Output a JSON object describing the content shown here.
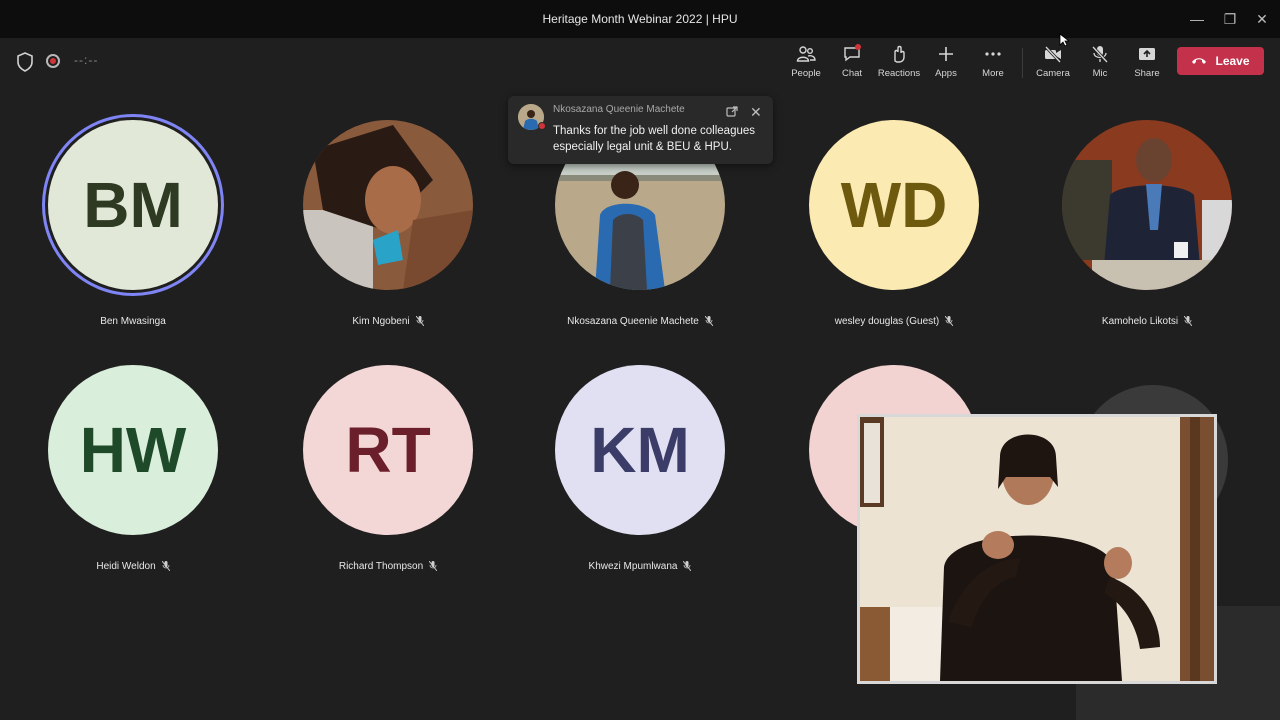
{
  "window": {
    "title": "Heritage Month Webinar 2022 | HPU"
  },
  "toolbar": {
    "timer": "--:--",
    "buttons": [
      {
        "icon": "people-icon",
        "label": "People"
      },
      {
        "icon": "chat-icon",
        "label": "Chat"
      },
      {
        "icon": "reactions-icon",
        "label": "Reactions"
      },
      {
        "icon": "apps-icon",
        "label": "Apps"
      },
      {
        "icon": "more-icon",
        "label": "More"
      },
      {
        "icon": "camera-off-icon",
        "label": "Camera"
      },
      {
        "icon": "mic-off-icon",
        "label": "Mic"
      },
      {
        "icon": "share-icon",
        "label": "Share"
      }
    ],
    "leave_label": "Leave",
    "leave_color": "#c4314b"
  },
  "participants": [
    {
      "initials": "BM",
      "name": "Ben Mwasinga",
      "bg": "#e2e8d8",
      "fg": "#2f3a22",
      "speaking": true,
      "muted": false
    },
    {
      "initials": "",
      "name": "Kim Ngobeni",
      "photo": true,
      "muted": true
    },
    {
      "initials": "",
      "name": "Nkosazana Queenie Machete",
      "photo": true,
      "muted": true
    },
    {
      "initials": "WD",
      "name": "wesley douglas (Guest)",
      "bg": "#fbeab1",
      "fg": "#6e5a0e",
      "muted": true
    },
    {
      "initials": "",
      "name": "Kamohelo Likotsi",
      "photo": true,
      "muted": true
    },
    {
      "initials": "HW",
      "name": "Heidi Weldon",
      "bg": "#d9eedb",
      "fg": "#1f4a2a",
      "muted": true
    },
    {
      "initials": "RT",
      "name": "Richard Thompson",
      "bg": "#f3d6d6",
      "fg": "#6b1f2a",
      "muted": true
    },
    {
      "initials": "KM",
      "name": "Khwezi Mpumlwana",
      "bg": "#e0e0f2",
      "fg": "#3b3d68",
      "muted": true
    }
  ],
  "toast": {
    "sender": "Nkosazana Queenie Machete",
    "message": "Thanks for the job well done colleagues especially legal unit & BEU & HPU."
  }
}
